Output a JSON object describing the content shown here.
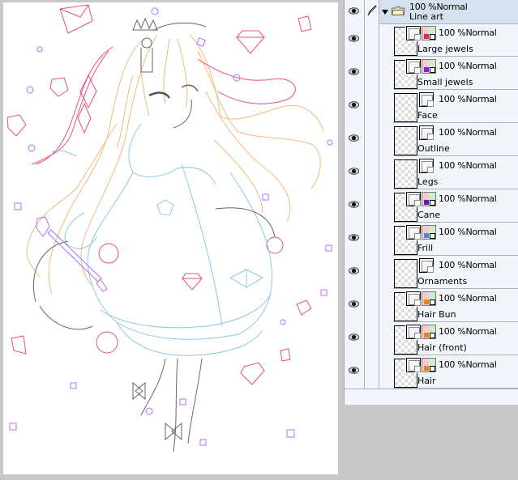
{
  "layers_panel": {
    "folder": {
      "opacity_mode": "100 %Normal",
      "name": "Line art",
      "visible": true,
      "expanded": true
    },
    "layers": [
      {
        "opacity_mode": "100 %Normal",
        "name": "Large jewels",
        "visible": true,
        "palette_color": "#e0245e"
      },
      {
        "opacity_mode": "100 %Normal",
        "name": "Small jewels",
        "visible": true,
        "palette_color": "#8a1fe0"
      },
      {
        "opacity_mode": "100 %Normal",
        "name": "Face",
        "visible": true,
        "palette_color": null
      },
      {
        "opacity_mode": "100 %Normal",
        "name": "Outline",
        "visible": true,
        "palette_color": null
      },
      {
        "opacity_mode": "100 %Normal",
        "name": "Legs",
        "visible": true,
        "palette_color": null
      },
      {
        "opacity_mode": "100 %Normal",
        "name": "Cane",
        "visible": true,
        "palette_color": "#5a16c8"
      },
      {
        "opacity_mode": "100 %Normal",
        "name": "Frill",
        "visible": true,
        "palette_color": "#3a8ee6"
      },
      {
        "opacity_mode": "100 %Normal",
        "name": "Ornaments",
        "visible": true,
        "palette_color": null
      },
      {
        "opacity_mode": "100 %Normal",
        "name": "Hair Bun",
        "visible": true,
        "palette_color": "#f08010"
      },
      {
        "opacity_mode": "100 %Normal",
        "name": "Hair (front)",
        "visible": true,
        "palette_color": "#f08010"
      },
      {
        "opacity_mode": "100 %Normal",
        "name": "Hair",
        "visible": true,
        "palette_color": "#f08010"
      }
    ]
  },
  "canvas": {
    "description": "Line-art illustration of a girl with long wavy hair, crown headband, frilled dress, holding a jewel cane, surrounded by jewels",
    "line_colors": {
      "hair": "#f3b97a",
      "frill": "#8cc8e6",
      "jewels": "#e8507a",
      "small_jewels": "#b070f0",
      "outline": "#555555"
    }
  }
}
